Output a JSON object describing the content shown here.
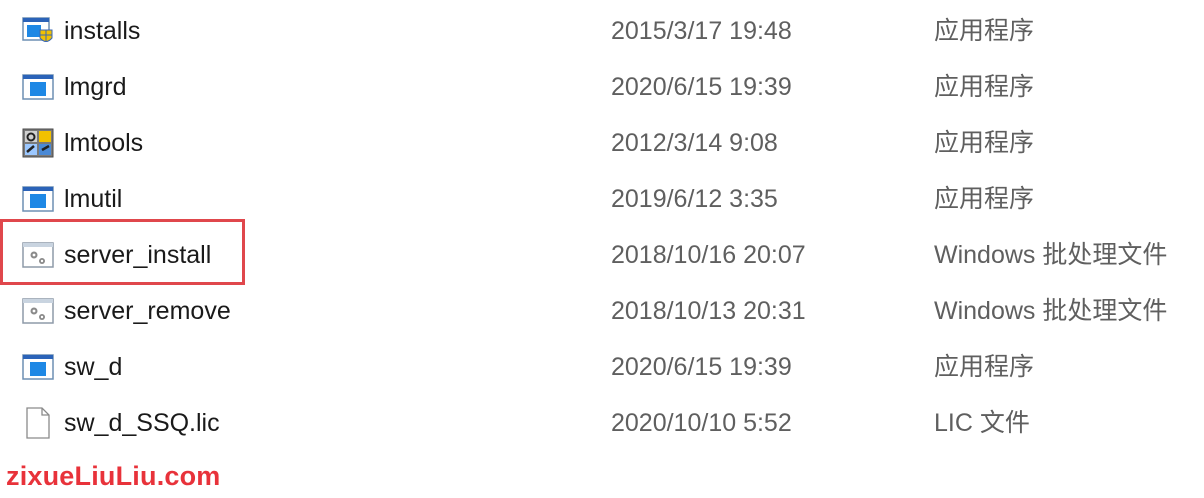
{
  "files": [
    {
      "name": "installs",
      "date": "2015/3/17 19:48",
      "type": "应用程序",
      "icon": "installer-shield-icon"
    },
    {
      "name": "lmgrd",
      "date": "2020/6/15 19:39",
      "type": "应用程序",
      "icon": "application-icon"
    },
    {
      "name": "lmtools",
      "date": "2012/3/14 9:08",
      "type": "应用程序",
      "icon": "tools-app-icon"
    },
    {
      "name": "lmutil",
      "date": "2019/6/12 3:35",
      "type": "应用程序",
      "icon": "application-icon"
    },
    {
      "name": "server_install",
      "date": "2018/10/16 20:07",
      "type": "Windows 批处理文件",
      "icon": "batch-file-icon"
    },
    {
      "name": "server_remove",
      "date": "2018/10/13 20:31",
      "type": "Windows 批处理文件",
      "icon": "batch-file-icon"
    },
    {
      "name": "sw_d",
      "date": "2020/6/15 19:39",
      "type": "应用程序",
      "icon": "application-icon"
    },
    {
      "name": "sw_d_SSQ.lic",
      "date": "2020/10/10 5:52",
      "type": "LIC 文件",
      "icon": "blank-file-icon"
    }
  ],
  "highlight_color": "#e0474c",
  "watermark": "zixueLiuLiu.com"
}
